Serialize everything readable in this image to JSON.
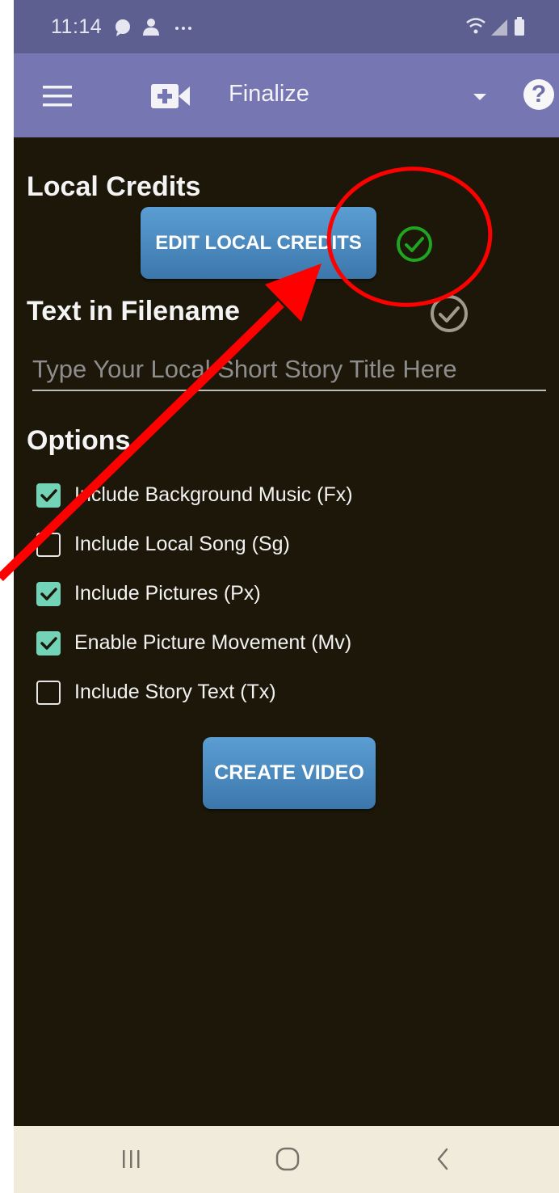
{
  "status_bar": {
    "time": "11:14",
    "left_icons": [
      "chat-bubble-icon",
      "person-icon",
      "more-dots-icon"
    ],
    "right_icons": [
      "wifi-icon",
      "cell-signal-icon",
      "battery-icon"
    ]
  },
  "app_bar": {
    "menu_icon": "hamburger-menu-icon",
    "app_icon": "add-video-icon",
    "title": "Finalize",
    "dropdown_icon": "dropdown-triangle-icon",
    "help_label": "?"
  },
  "local_credits": {
    "heading": "Local Credits",
    "edit_button": "EDIT LOCAL CREDITS",
    "status_icon": "check-circle-icon",
    "status_color": "#1fa51f"
  },
  "filename": {
    "heading": "Text in Filename",
    "status_icon": "check-circle-icon",
    "status_color": "#a09a8e",
    "input_value": "",
    "input_placeholder": "Type Your Local Short Story Title Here"
  },
  "options": {
    "heading": "Options",
    "items": [
      {
        "label": "Include Background Music (Fx)",
        "checked": true
      },
      {
        "label": "Include Local Song (Sg)",
        "checked": false
      },
      {
        "label": "Include Pictures (Px)",
        "checked": true
      },
      {
        "label": "Enable Picture Movement (Mv)",
        "checked": true
      },
      {
        "label": "Include Story Text (Tx)",
        "checked": false
      }
    ]
  },
  "create_button": "CREATE VIDEO",
  "nav_bar": {
    "icons": [
      "recent-apps-icon",
      "home-icon",
      "back-icon"
    ]
  },
  "annotation": {
    "color": "#ff0000",
    "shapes": [
      "red-circle-annotation",
      "red-arrow-annotation"
    ]
  },
  "colors": {
    "status_bar": "#5e5f91",
    "app_bar": "#7676b2",
    "background": "#1c1709",
    "checkbox_checked": "#72d3b7",
    "button": "#4a8bc2",
    "nav_bar": "#f1ebdb"
  }
}
